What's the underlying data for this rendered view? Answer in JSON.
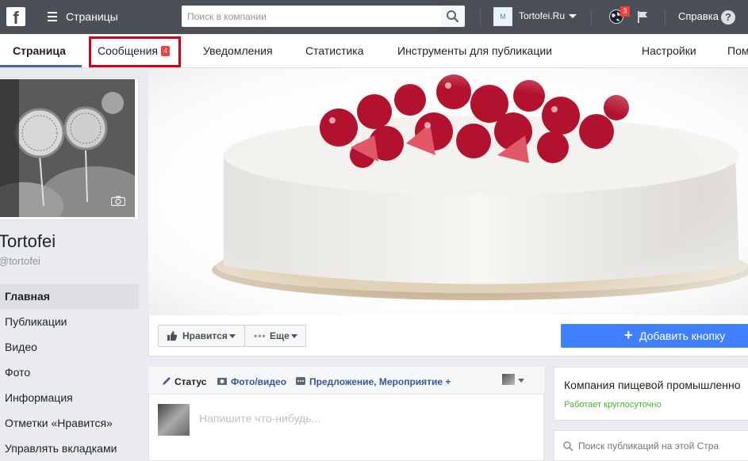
{
  "topbar": {
    "logo_letter": "f",
    "pages_label": "Страницы",
    "search_placeholder": "Поиск в компании",
    "page_avatar_text": "M",
    "page_name": "Tortofei.Ru",
    "notifications_count": "3",
    "help_label": "Справка",
    "help_icon_glyph": "?"
  },
  "tabs": {
    "page": "Страница",
    "messages": "Сообщения",
    "messages_badge": "4",
    "notifications": "Уведомления",
    "stats": "Статистика",
    "publishing_tools": "Инструменты для публикации",
    "settings": "Настройки",
    "help_partial": "Пом"
  },
  "profile": {
    "title": "Tortofei",
    "handle": "@tortofei"
  },
  "sidebar": {
    "items": [
      {
        "label": "Главная"
      },
      {
        "label": "Публикации"
      },
      {
        "label": "Видео"
      },
      {
        "label": "Фото"
      },
      {
        "label": "Информация"
      },
      {
        "label": "Отметки «Нравится»"
      },
      {
        "label": "Управлять вкладками"
      }
    ]
  },
  "cover": {
    "like_label": "Нравится",
    "more_label": "Еще",
    "add_button_label": "Добавить кнопку",
    "add_button_icon": "+"
  },
  "composer": {
    "status_label": "Статус",
    "photo_video_label": "Фото/видео",
    "offer_event_label": "Предложение, Мероприятие +",
    "placeholder": "Напишите что-нибудь..."
  },
  "right": {
    "company_label": "Компания пищевой промышленно",
    "hours_label": "Работает круглосуточно",
    "search_placeholder": "Поиск публикаций на этой Стра"
  },
  "colors": {
    "topbar": "#4b4f56",
    "accent_blue": "#4080ff",
    "link_blue": "#365899",
    "open_green": "#42b72a",
    "badge_red": "#fa3e3e",
    "highlight_red": "#d0021b"
  }
}
